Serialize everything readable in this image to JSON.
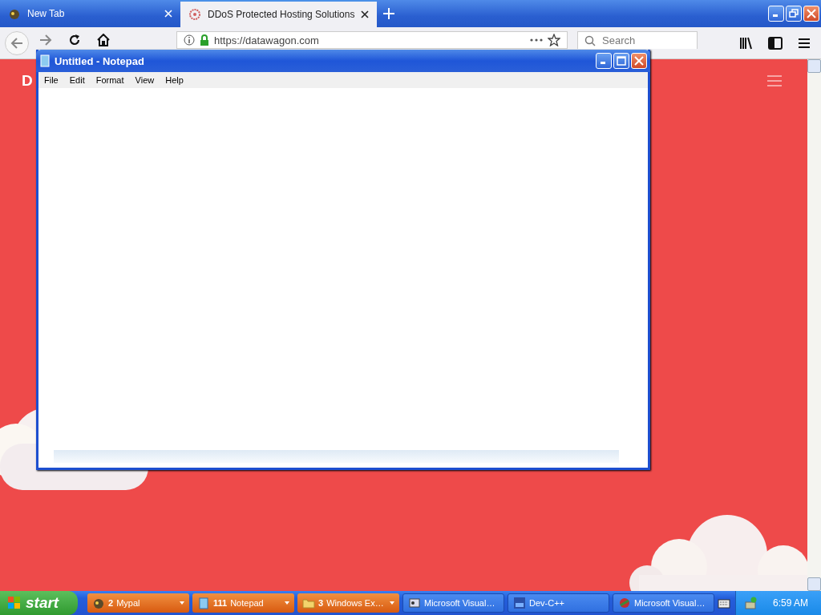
{
  "browser": {
    "tabs": [
      {
        "label": "New Tab",
        "selected": false
      },
      {
        "label": "DDoS Protected Hosting Solutions",
        "selected": true
      }
    ],
    "url": "https://datawagon.com",
    "search": {
      "placeholder": "Search"
    },
    "page": {
      "logo": "D"
    }
  },
  "notepad": {
    "title": "Untitled - Notepad",
    "menu": [
      "File",
      "Edit",
      "Format",
      "View",
      "Help"
    ]
  },
  "taskbar": {
    "start": "start",
    "buttons": [
      {
        "kind": "group",
        "count": "2",
        "label": "Mypal"
      },
      {
        "kind": "group",
        "count": "111",
        "label": "Notepad"
      },
      {
        "kind": "group",
        "count": "3",
        "label": "Windows Ex…"
      },
      {
        "kind": "single",
        "label": "Microsoft Visual…"
      },
      {
        "kind": "single",
        "label": "Dev-C++"
      },
      {
        "kind": "single",
        "label": "Microsoft Visual…"
      }
    ],
    "clock": "6:59 AM"
  }
}
